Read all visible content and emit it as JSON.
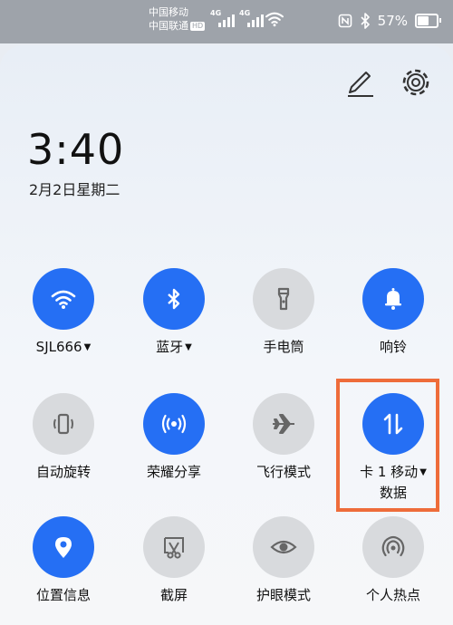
{
  "status_bar": {
    "carrier_1": "中国移动",
    "carrier_2": "中国联通",
    "hd_badge": "HD",
    "network_1": "4G",
    "network_2": "4G",
    "battery": "57%"
  },
  "header": {
    "time": "3:40",
    "date": "2月2日星期二"
  },
  "tiles": {
    "wifi": "SJL666",
    "bluetooth": "蓝牙",
    "flashlight": "手电筒",
    "ring": "响铃",
    "rotate": "自动旋转",
    "share": "荣耀分享",
    "airplane": "飞行模式",
    "mobile_data_line1": "卡 1 移动",
    "mobile_data_line2": "数据",
    "location": "位置信息",
    "screenshot": "截屏",
    "eye_comfort": "护眼模式",
    "hotspot": "个人热点"
  },
  "colors": {
    "active": "#256ff4",
    "inactive": "#d8dadd",
    "highlight_box": "#ee6c3a"
  },
  "icons": [
    "wifi-icon",
    "bluetooth-icon",
    "flashlight-icon",
    "bell-icon",
    "rotate-icon",
    "share-icon",
    "airplane-icon",
    "data-arrows-icon",
    "location-icon",
    "screenshot-icon",
    "eye-icon",
    "hotspot-icon",
    "edit-icon",
    "gear-icon"
  ]
}
